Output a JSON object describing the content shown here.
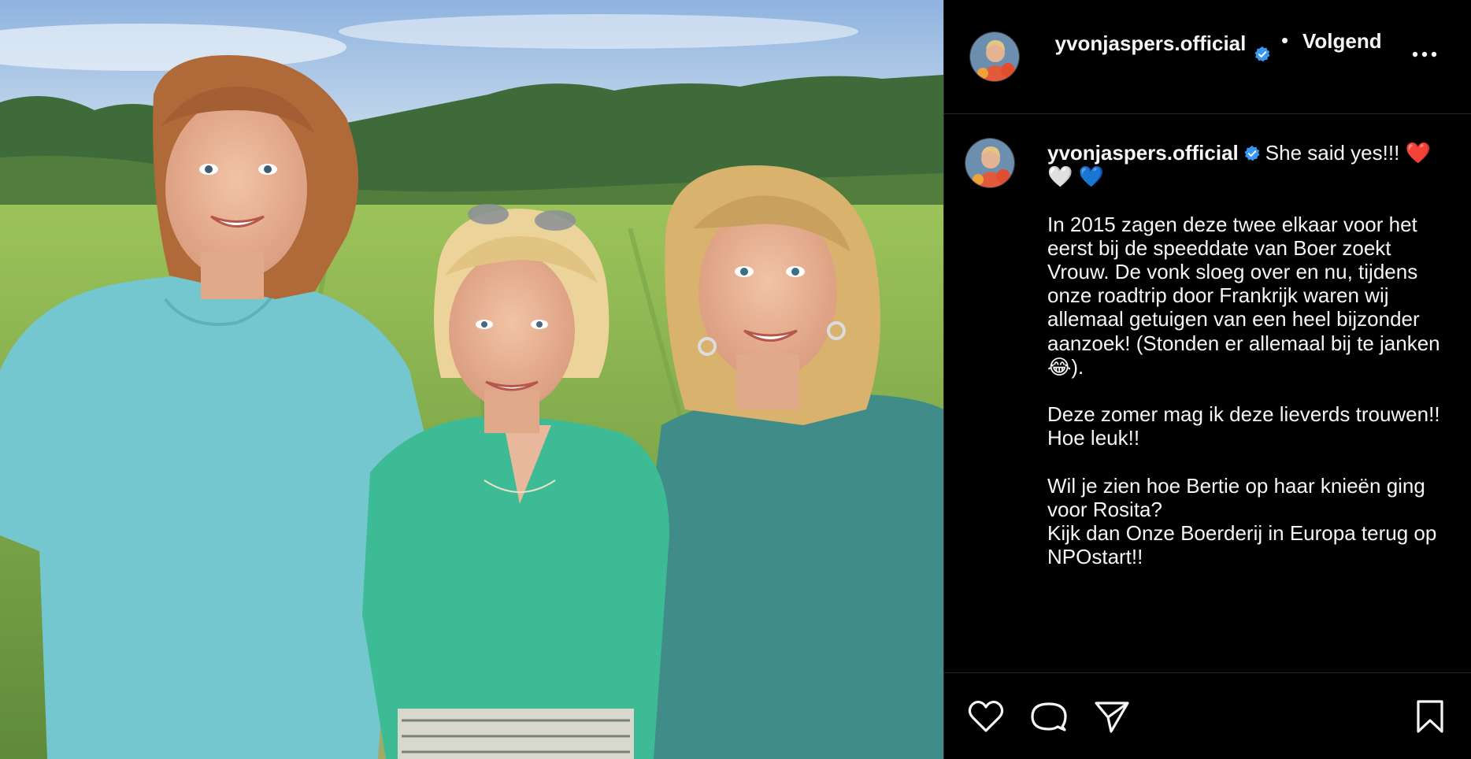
{
  "post": {
    "image_alt": "Three women smiling in a vineyard",
    "author": {
      "username": "yvonjaspers.official",
      "verified": true,
      "follow_status": "Volgend",
      "separator": "•"
    },
    "caption": {
      "username": "yvonjaspers.official",
      "text": "She said yes!!! ❤️ 🤍 💙\n\nIn 2015 zagen deze twee elkaar voor het eerst bij de speeddate van Boer zoekt Vrouw. De vonk sloeg over en nu, tijdens onze roadtrip door Frankrijk waren wij allemaal getuigen van een heel bijzonder aanzoek! (Stonden er allemaal bij te janken 😂).\n\nDeze zomer mag ik deze lieverds trouwen!! Hoe leuk!!\n\nWil je zien hoe Bertie op haar knieën ging voor Rosita?\nKijk dan Onze Boerderij in Europa terug op NPOstart!!"
    },
    "icons": {
      "more": "more-options-icon",
      "like": "heart-icon",
      "comment": "comment-icon",
      "share": "paper-plane-icon",
      "save": "bookmark-icon",
      "verified": "verified-badge-icon"
    },
    "colors": {
      "background": "#000000",
      "text": "#f5f5f5",
      "verified": "#3897f0",
      "divider": "#262626"
    }
  }
}
